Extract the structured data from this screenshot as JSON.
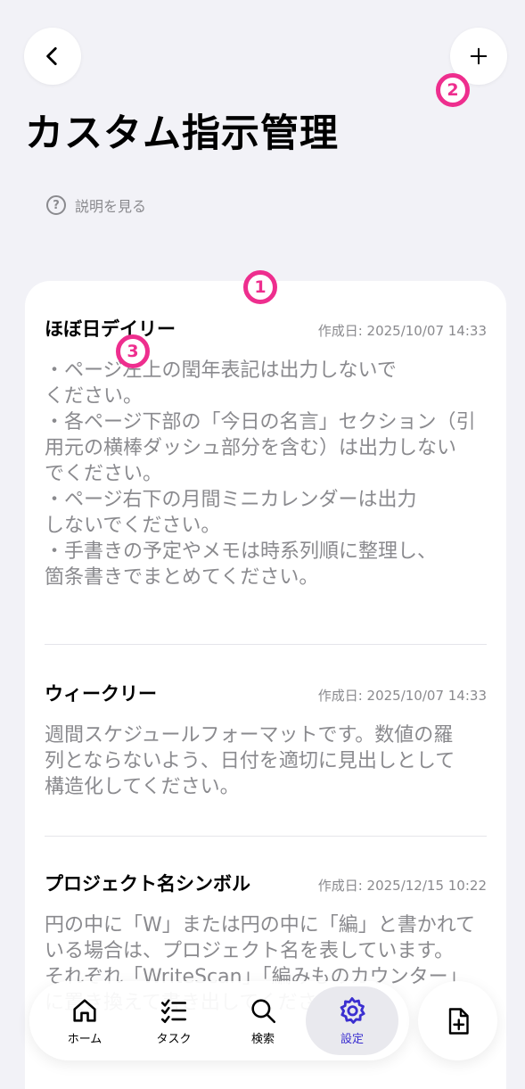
{
  "header": {
    "title": "カスタム指示管理",
    "back_label": "‹",
    "add_label": "+",
    "help_text": "説明を見る",
    "help_icon_char": "?"
  },
  "annotations": {
    "badge_1": "1",
    "badge_2": "2",
    "badge_3": "3"
  },
  "instructions": [
    {
      "title": "ほぼ日デイリー",
      "date": "作成日: 2025/10/07 14:33",
      "body": "・ページ左上の閏年表記は出力しないで\nください。\n・各ページ下部の「今日の名言」セクション（引\n用元の横棒ダッシュ部分を含む）は出力しない\nでください。\n・ページ右下の月間ミニカレンダーは出力\nしないでください。\n・手書きの予定やメモは時系列順に整理し、\n箇条書きでまとめてください。"
    },
    {
      "title": "ウィークリー",
      "date": "作成日: 2025/10/07 14:33",
      "body": "週間スケジュールフォーマットです。数値の羅\n列とならないよう、日付を適切に見出しとして\n構造化してください。"
    },
    {
      "title": "プロジェクト名シンボル",
      "date": "作成日: 2025/12/15 10:22",
      "body": "円の中に「W」または円の中に「編」と書かれて\nいる場合は、プロジェクト名を表しています。\nそれぞれ「WriteScan」「編みものカウンター」\nに置き換えて書き出してください。"
    }
  ],
  "nav": {
    "home": "ホーム",
    "task": "タスク",
    "search": "検索",
    "settings": "設定"
  },
  "colors": {
    "accent": "#3b2fd0",
    "annotation": "#ee2e8e",
    "secondary_text": "#8a8a8e"
  }
}
